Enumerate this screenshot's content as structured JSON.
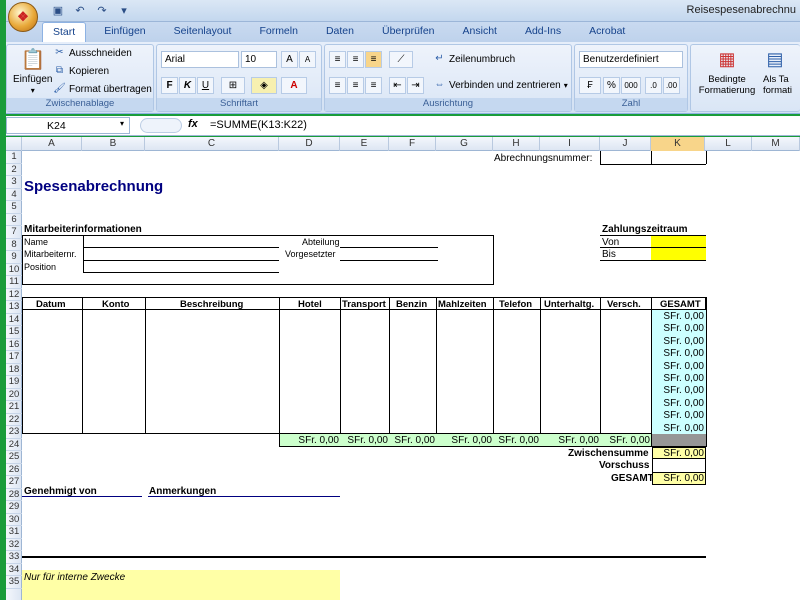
{
  "window": {
    "title": "Reisespesenabrechnu"
  },
  "tabs": [
    "Start",
    "Einfügen",
    "Seitenlayout",
    "Formeln",
    "Daten",
    "Überprüfen",
    "Ansicht",
    "Add-Ins",
    "Acrobat"
  ],
  "ribbon": {
    "clipboard": {
      "title": "Zwischenablage",
      "paste": "Einfügen",
      "cut": "Ausschneiden",
      "copy": "Kopieren",
      "format_painter": "Format übertragen"
    },
    "font": {
      "title": "Schriftart",
      "font_name": "Arial",
      "font_size": "10",
      "bold": "F",
      "italic": "K",
      "underline": "U"
    },
    "alignment": {
      "title": "Ausrichtung",
      "wrap": "Zeilenumbruch",
      "merge": "Verbinden und zentrieren"
    },
    "number": {
      "title": "Zahl",
      "format": "Benutzerdefiniert",
      "percent": "%",
      "thousands": "000"
    },
    "styles": {
      "cond_format": "Bedingte Formatierung",
      "as_table": "Als Ta formati"
    }
  },
  "formula_bar": {
    "name_box": "K24",
    "fx": "fx",
    "formula": "=SUMME(K13:K22)"
  },
  "columns": [
    "A",
    "B",
    "C",
    "D",
    "E",
    "F",
    "G",
    "H",
    "I",
    "J",
    "K",
    "L",
    "M"
  ],
  "rows": [
    "1",
    "2",
    "3",
    "4",
    "5",
    "6",
    "7",
    "8",
    "9",
    "10",
    "11",
    "12",
    "13",
    "14",
    "15",
    "16",
    "17",
    "18",
    "19",
    "20",
    "21",
    "22",
    "23",
    "24",
    "25",
    "26",
    "27",
    "28",
    "29",
    "30",
    "31",
    "32",
    "33",
    "34",
    "35"
  ],
  "sheet": {
    "abrechnungsnummer": "Abrechnungsnummer:",
    "title": "Spesenabrechnung",
    "mitarbeiter_header": "Mitarbeiterinformationen",
    "name": "Name",
    "mitarbeiternr": "Mitarbeiternr.",
    "position": "Position",
    "abteilung": "Abteilung",
    "vorgesetzter": "Vorgesetzter",
    "zahlungszeitraum": "Zahlungszeitraum",
    "von": "Von",
    "bis": "Bis",
    "table_headers": [
      "Datum",
      "Konto",
      "Beschreibung",
      "Hotel",
      "Transport",
      "Benzin",
      "Mahlzeiten",
      "Telefon",
      "Unterhaltg.",
      "Versch.",
      "GESAMT"
    ],
    "row_totals": [
      "SFr. 0,00",
      "SFr. 0,00",
      "SFr. 0,00",
      "SFr. 0,00",
      "SFr. 0,00",
      "SFr. 0,00",
      "SFr. 0,00",
      "SFr. 0,00",
      "SFr. 0,00",
      "SFr. 0,00"
    ],
    "col_totals": [
      "SFr. 0,00",
      "SFr. 0,00",
      "SFr. 0,00",
      "SFr. 0,00",
      "SFr. 0,00",
      "SFr. 0,00",
      "SFr. 0,00"
    ],
    "zwischensumme": "Zwischensumme",
    "zwischensumme_val": "SFr. 0,00",
    "vorschuss": "Vorschuss",
    "gesamt": "GESAMT",
    "gesamt_val": "SFr. 0,00",
    "genehmigt": "Genehmigt von",
    "anmerkungen": "Anmerkungen",
    "intern": "Nur für interne Zwecke"
  },
  "colors": {
    "yellow": "#ffff00",
    "lightyellow": "#ffffa6",
    "cyan": "#ccffff",
    "green": "#ccffcc",
    "gray": "#969696",
    "navy": "#000080"
  }
}
